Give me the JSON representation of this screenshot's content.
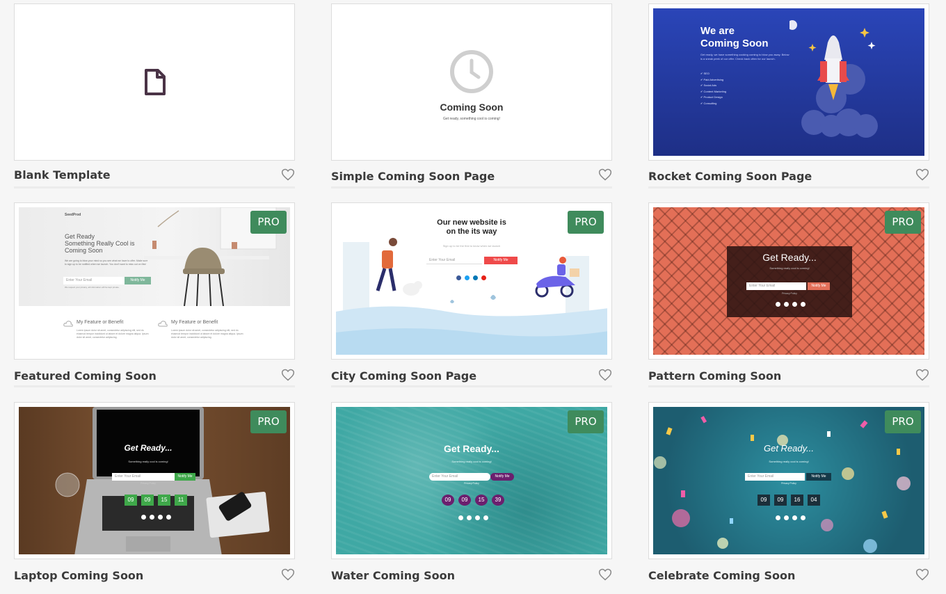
{
  "badge_label": "PRO",
  "cards": [
    {
      "title": "Blank Template",
      "pro": false
    },
    {
      "title": "Simple Coming Soon Page",
      "pro": false,
      "preview": {
        "heading": "Coming Soon",
        "sub": "Get ready, something cool is coming!"
      }
    },
    {
      "title": "Rocket Coming Soon Page",
      "pro": false,
      "preview": {
        "heading_1": "We are",
        "heading_2": "Coming Soon",
        "body": "Get ready, we have something cooking coming to blow you away. Below is a sneak peek of our offer. Check back often for our launch.",
        "list": [
          "SEO",
          "Paid Advertising",
          "Social Ads",
          "Content Marketing",
          "Product Design",
          "Consulting"
        ]
      }
    },
    {
      "title": "Featured Coming Soon",
      "pro": true,
      "preview": {
        "logo": "SeedProd",
        "heading_1": "Get Ready",
        "heading_2": "Something Really Cool is",
        "heading_3": "Coming Soon",
        "body": "We are going to blow your mind so you see what we have to offer. Make sure to sign up to be notified when we launch. You don't want to miss out on this!",
        "email_placeholder": "Enter Your Email",
        "button": "Notify Me",
        "privacy": "We respect your privacy, all information will be kept private.",
        "feature_1": "My Feature or Benefit",
        "feature_2": "My Feature or Benefit",
        "feature_body": "Lorem ipsum dolor sit amet, consectetur adipiscing elit, sed do eiusmod tempor incididunt ut labore et dolore magna aliqua. Ipsum dolor sit amet, consectetur adipiscing."
      }
    },
    {
      "title": "City Coming Soon Page",
      "pro": true,
      "preview": {
        "heading_1": "Our new website is",
        "heading_2": "on the its way",
        "sub": "Sign up to be the first to know when we launch",
        "email_placeholder": "Enter Your Email",
        "button": "Notify Me"
      }
    },
    {
      "title": "Pattern Coming Soon",
      "pro": true,
      "preview": {
        "heading": "Get Ready...",
        "sub": "Something really cool is coming!",
        "email_placeholder": "Enter Your Email",
        "button": "Notify Me",
        "privacy": "Privacy Policy"
      }
    },
    {
      "title": "Laptop Coming Soon",
      "pro": true,
      "preview": {
        "heading": "Get Ready...",
        "sub": "Something really cool is coming!",
        "email_placeholder": "Enter Your Email",
        "button": "Notify Me",
        "privacy": "Privacy Policy",
        "countdown": [
          "09",
          "09",
          "15",
          "11"
        ]
      }
    },
    {
      "title": "Water Coming Soon",
      "pro": true,
      "preview": {
        "heading": "Get Ready...",
        "sub": "Something really cool is coming!",
        "email_placeholder": "Enter Your Email",
        "button": "Notify Me",
        "privacy": "Privacy Policy",
        "countdown": [
          "09",
          "09",
          "15",
          "39"
        ]
      }
    },
    {
      "title": "Celebrate Coming Soon",
      "pro": true,
      "preview": {
        "heading": "Get Ready...",
        "sub": "Something really cool is coming!",
        "email_placeholder": "Enter Your Email",
        "button": "Notify Me",
        "privacy": "Privacy Policy",
        "countdown": [
          "09",
          "09",
          "16",
          "04"
        ]
      }
    }
  ],
  "colors": {
    "pro_badge": "#3f8b5c",
    "title_text": "#3b3b3b",
    "heart_outline": "#888888"
  }
}
